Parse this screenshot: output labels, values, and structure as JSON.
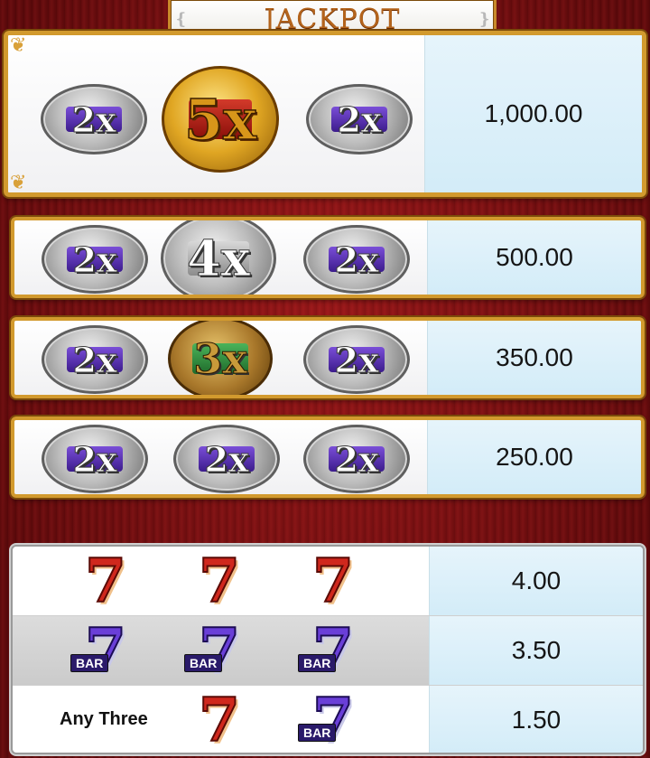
{
  "title": "JACKPOT",
  "colors": {
    "background_red": "#8f1416",
    "gold_border": "#d29a2e",
    "payout_blue": "#dff0f8",
    "red_seven": "#d0281d",
    "blue_seven": "#6a3fd8"
  },
  "multiplier_rows": [
    {
      "symbols": [
        {
          "label": "2x",
          "icon": "times-two-badge"
        },
        {
          "label": "5x",
          "icon": "times-five-badge"
        },
        {
          "label": "2x",
          "icon": "times-two-badge"
        }
      ],
      "payout": "1,000.00"
    },
    {
      "symbols": [
        {
          "label": "2x",
          "icon": "times-two-badge"
        },
        {
          "label": "4x",
          "icon": "times-four-badge"
        },
        {
          "label": "2x",
          "icon": "times-two-badge"
        }
      ],
      "payout": "500.00"
    },
    {
      "symbols": [
        {
          "label": "2x",
          "icon": "times-two-badge"
        },
        {
          "label": "3x",
          "icon": "times-three-badge"
        },
        {
          "label": "2x",
          "icon": "times-two-badge"
        }
      ],
      "payout": "350.00"
    },
    {
      "symbols": [
        {
          "label": "2x",
          "icon": "times-two-badge"
        },
        {
          "label": "2x",
          "icon": "times-two-badge"
        },
        {
          "label": "2x",
          "icon": "times-two-badge"
        }
      ],
      "payout": "250.00"
    }
  ],
  "sevens_rows": [
    {
      "symbols": [
        "red-seven-icon",
        "red-seven-icon",
        "red-seven-icon"
      ],
      "payout": "4.00"
    },
    {
      "symbols": [
        "blue-bar-seven-icon",
        "blue-bar-seven-icon",
        "blue-bar-seven-icon"
      ],
      "payout": "3.50"
    },
    {
      "label": "Any Three",
      "symbols": [
        "red-seven-icon",
        "blue-bar-seven-icon"
      ],
      "payout": "1.50"
    }
  ],
  "seven_glyph": "7",
  "bar_glyph": "BAR"
}
